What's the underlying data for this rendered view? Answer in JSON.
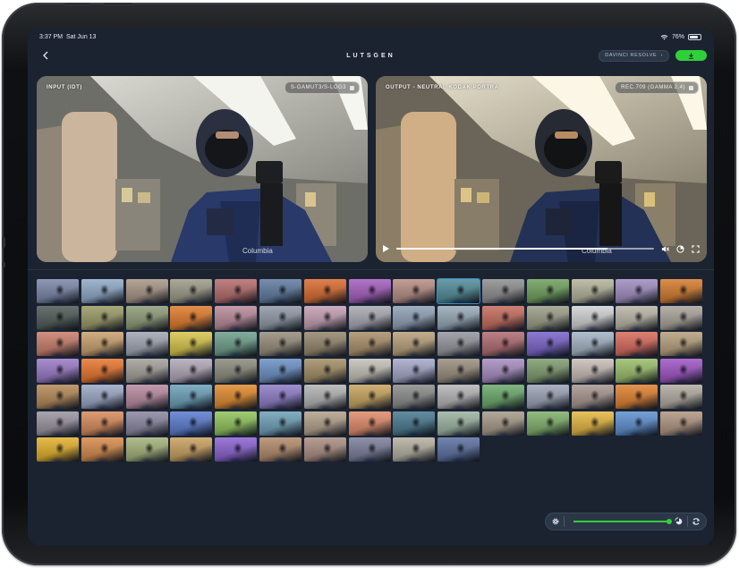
{
  "status_bar": {
    "time": "3:37 PM",
    "date": "Sat Jun 13",
    "battery": "76%"
  },
  "header": {
    "app_title": "LUTSGEN",
    "target_app": "DAVINCI RESOLVE",
    "target_chevron": "›"
  },
  "input_panel": {
    "label": "INPUT (IDT)",
    "colorspace": "S-GAMUT3/S-LOG3"
  },
  "output_panel": {
    "label": "OUTPUT - NEUTRAL KODAK PORTRA",
    "colorspace": "REC.709 (GAMMA 2.4)",
    "playback_progress": 0.82
  },
  "toolbar": {
    "intensity": 0.98
  },
  "icons": [
    "back-icon",
    "wifi-icon",
    "battery-icon",
    "download-icon",
    "play-icon",
    "mute-icon",
    "pip-icon",
    "fullscreen-icon",
    "gear-icon",
    "compare-icon",
    "refresh-icon"
  ],
  "colors": {
    "accent": "#2fd13b",
    "screen_bg": "#1b2331",
    "selected_outline": "#3b89c9"
  },
  "thumbnails": [
    [
      "#7a86a8",
      "#8fa9c7",
      "#a79585",
      "#9c9a86",
      "#b56b6b",
      "#5f7aa0",
      "#d96b2e",
      "#a45dbe",
      "#b78d85",
      "#4f8c97",
      "#8e8e8e",
      "#6fa05c",
      "#b3b39a",
      "#9f8dc0",
      "#d47b2c"
    ],
    [
      "#4f5a55",
      "#9a9a66",
      "#8d9b78",
      "#e07a2a",
      "#b98a9a",
      "#8f9aa6",
      "#c49fb3",
      "#a8a9b2",
      "#8fa1b5",
      "#97a9b8",
      "#c46b5c",
      "#9b9e86",
      "#d1d2d3",
      "#b9b5a6",
      "#aaa39a"
    ],
    [
      "#c87d6a",
      "#c9a06d",
      "#a0a6b3",
      "#d7c54a",
      "#6d9e8a",
      "#968d7a",
      "#94866d",
      "#aa8f6a",
      "#b7a07a",
      "#94969c",
      "#b06b70",
      "#7a63c9",
      "#a4b3c3",
      "#d86a5c",
      "#b6a07c"
    ],
    [
      "#9a79c6",
      "#e8752d",
      "#a4a09a",
      "#b2a7b8",
      "#8a8a7c",
      "#6b8fc4",
      "#a28e66",
      "#c4c0b8",
      "#a5a7c9",
      "#9a8e7d",
      "#a78dc0",
      "#7e9c6e",
      "#c8bdb8",
      "#9bbe6a",
      "#9f54c6"
    ],
    [
      "#b48856",
      "#9aa7c5",
      "#b78a9e",
      "#6ba0b9",
      "#e08a2c",
      "#8d7cc7",
      "#b3b3b3",
      "#c7a45e",
      "#8a8c8a",
      "#b6b4b5",
      "#6aa86a",
      "#9ba3b6",
      "#a89590",
      "#e0802f",
      "#b1aba0"
    ],
    [
      "#9a94a0",
      "#d88a5a",
      "#8b86a0",
      "#5a7bd0",
      "#8fc35a",
      "#6ea0b7",
      "#b3a08a",
      "#e08b6a",
      "#48788f",
      "#9bb3a0",
      "#a69a88",
      "#7fb06a",
      "#e3b640",
      "#5e8fd0",
      "#b09580"
    ],
    [
      "#e2b02a",
      "#d68a4a",
      "#a4b27a",
      "#c9a060",
      "#8a62d0",
      "#b28a6a",
      "#ab8d82",
      "#7a7e9a",
      "#b4b0a0",
      "#5a6fa0"
    ]
  ]
}
